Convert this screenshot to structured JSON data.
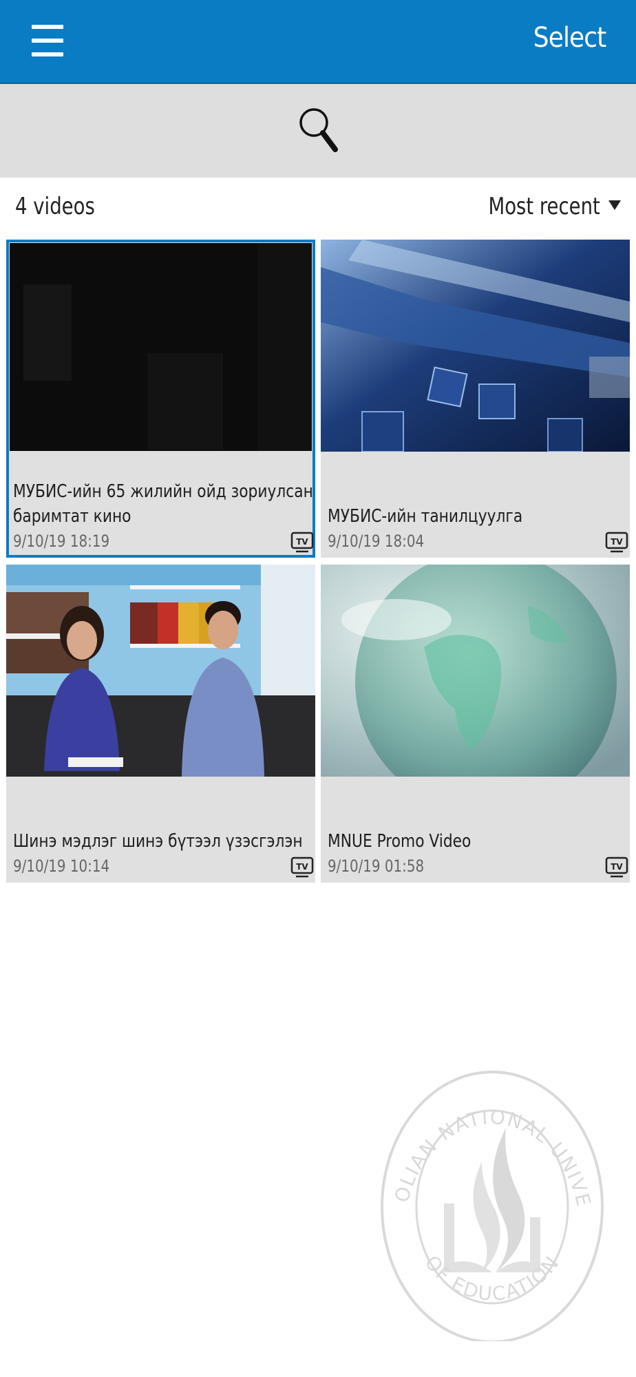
{
  "header": {
    "menu_icon": "hamburger-menu-icon",
    "select_label": "Select",
    "accent_color": "#0a7cc4"
  },
  "search": {
    "icon": "search-icon"
  },
  "list": {
    "count_label": "4 videos",
    "sort_label": "Most recent"
  },
  "videos": [
    {
      "title": "МУБИС-ийн 65 жилийн ойд зориулсан баримтат кино",
      "date": "9/10/19 18:19",
      "badge": "TV",
      "selected": true
    },
    {
      "title": "МУБИС-ийн танилцуулга",
      "date": "9/10/19 18:04",
      "badge": "TV",
      "selected": false
    },
    {
      "title": "Шинэ мэдлэг шинэ бүтээл үзэсгэлэн",
      "date": "9/10/19 10:14",
      "badge": "TV",
      "selected": false
    },
    {
      "title": "MNUE Promo Video",
      "date": "9/10/19 01:58",
      "badge": "TV",
      "selected": false
    }
  ],
  "watermark": {
    "arc_text_top": "MONGOLIAN NATIONAL UNIVERSITY",
    "arc_text_bottom": "OF EDUCATION"
  }
}
